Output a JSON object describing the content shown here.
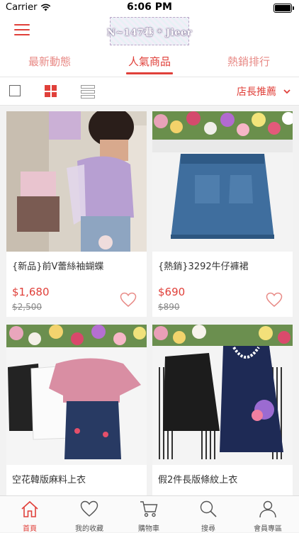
{
  "status": {
    "carrier": "Carrier",
    "time": "6:06 PM"
  },
  "header": {
    "logo_text": "N~147巷 * Jieer"
  },
  "tabs": [
    {
      "label": "最新動態"
    },
    {
      "label": "人氣商品",
      "active": true
    },
    {
      "label": "熱銷排行"
    }
  ],
  "filter": {
    "sort_label": "店長推薦"
  },
  "products": [
    {
      "title": "{新品}前V蕾絲袖蝴蝶",
      "price": "$1,680",
      "old_price": "$2,500"
    },
    {
      "title": "{熱銷}3292牛仔褲裙",
      "price": "$690",
      "old_price": "$890"
    },
    {
      "title": "空花韓版麻料上衣",
      "price": "",
      "old_price": ""
    },
    {
      "title": "假2件長版條紋上衣",
      "price": "",
      "old_price": ""
    }
  ],
  "tabbar": [
    {
      "label": "首頁",
      "icon": "home-icon",
      "active": true
    },
    {
      "label": "我的收藏",
      "icon": "heart-icon"
    },
    {
      "label": "購物車",
      "icon": "cart-icon"
    },
    {
      "label": "搜尋",
      "icon": "search-icon"
    },
    {
      "label": "會員專區",
      "icon": "user-icon"
    }
  ],
  "colors": {
    "accent": "#e0403a",
    "accent_light": "#e88a86"
  }
}
